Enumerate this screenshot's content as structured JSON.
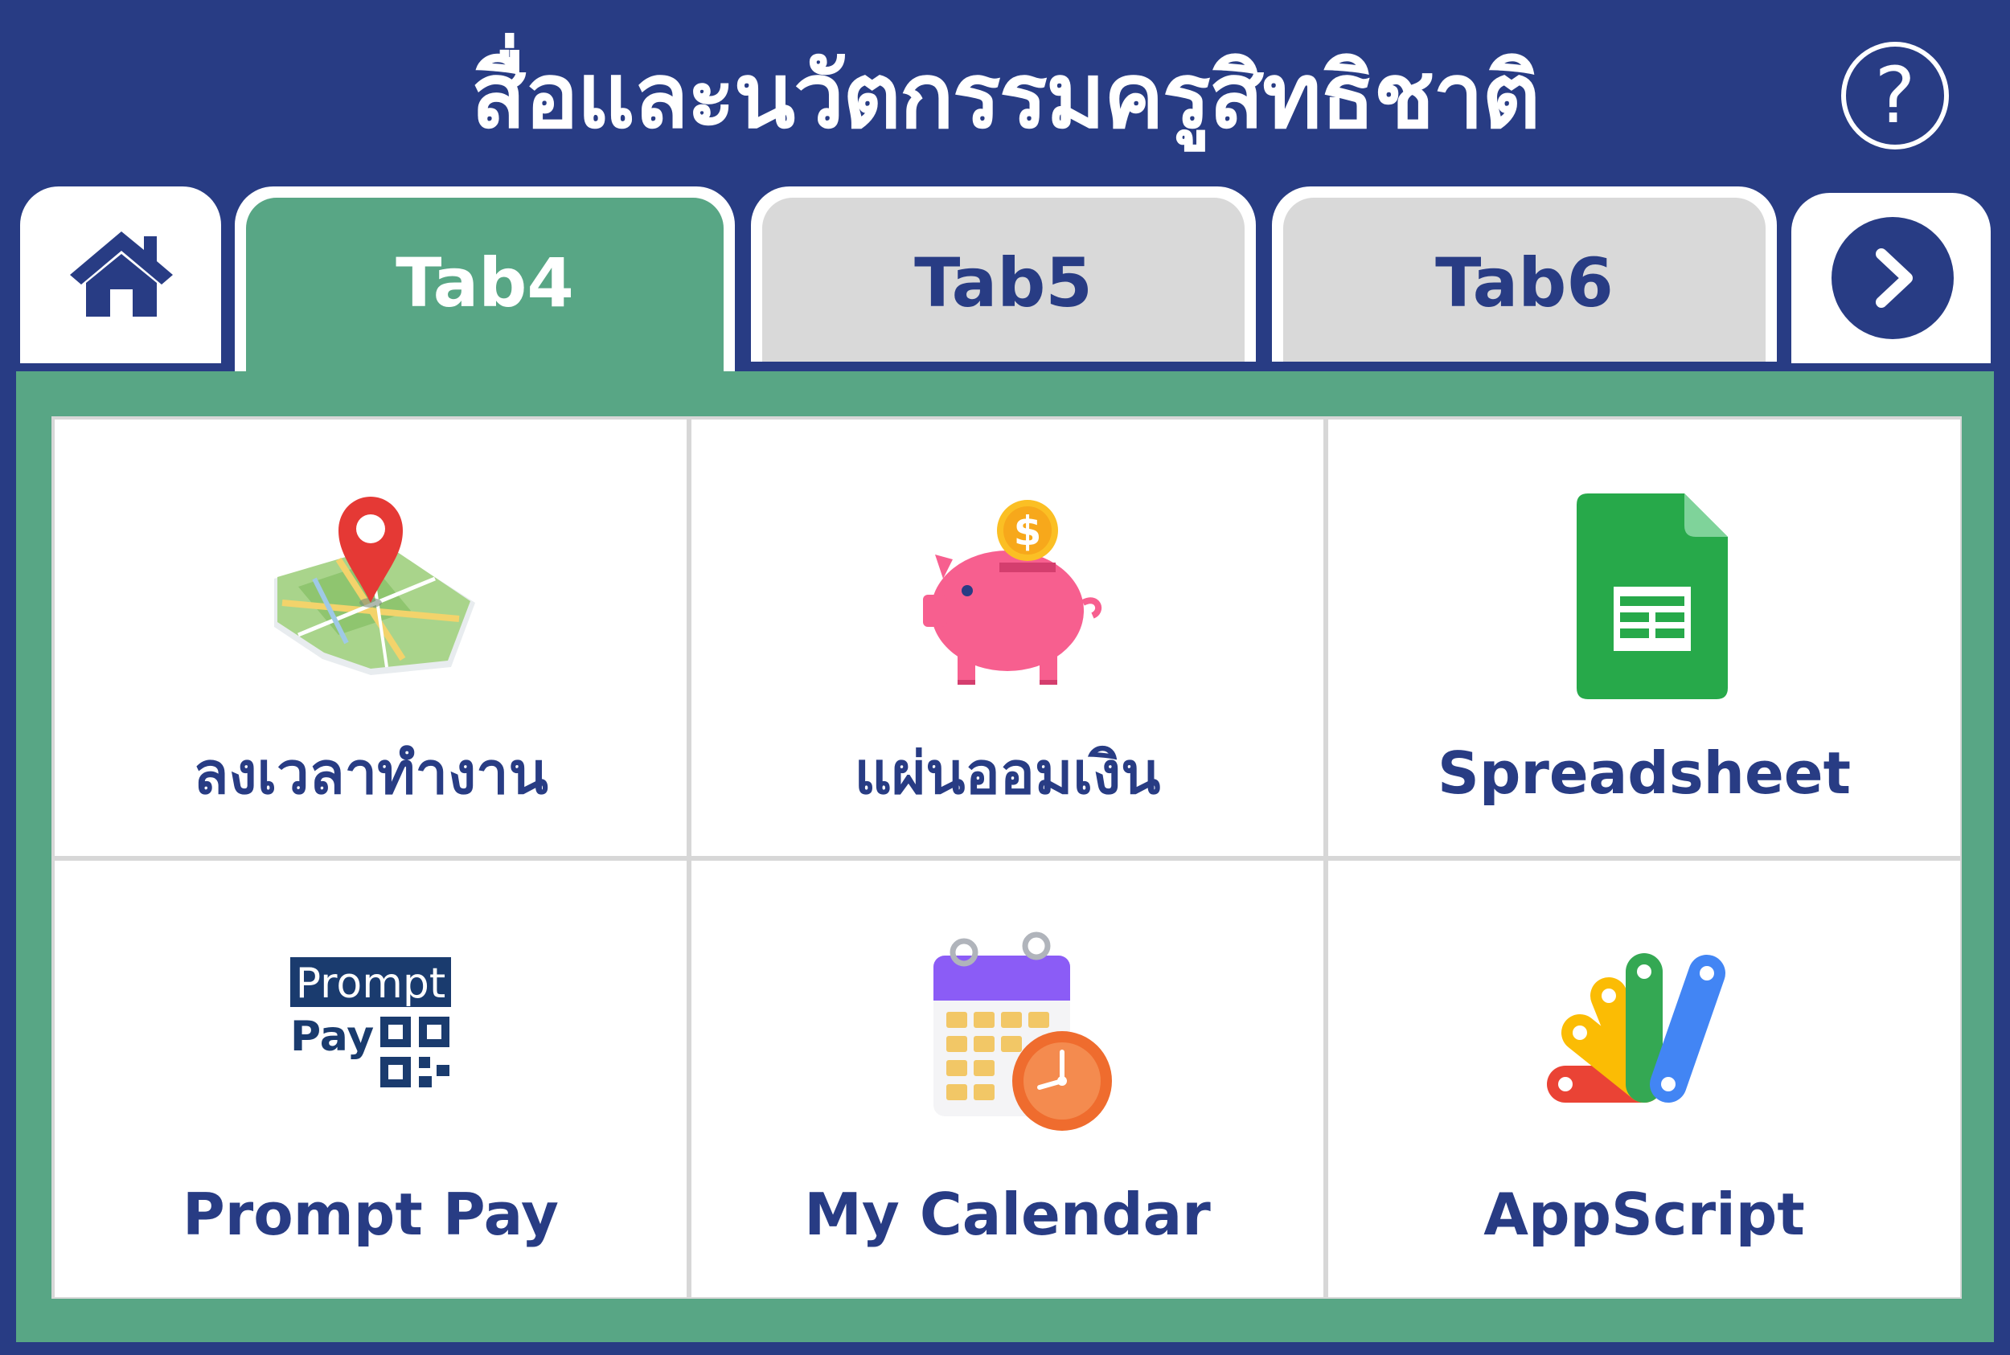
{
  "header": {
    "title": "สื่อและนวัตกรรมครูสิทธิชาติ",
    "help_symbol": "?"
  },
  "tabs": [
    {
      "label": "Tab4",
      "active": true
    },
    {
      "label": "Tab5",
      "active": false
    },
    {
      "label": "Tab6",
      "active": false
    }
  ],
  "nav": {
    "home_icon": "home-icon",
    "next_icon": "chevron-right-icon"
  },
  "cards": [
    {
      "label": "ลงเวลาทำงาน",
      "icon": "map-pin-icon"
    },
    {
      "label": "แผ่นออมเงิน",
      "icon": "piggy-bank-icon"
    },
    {
      "label": "Spreadsheet",
      "icon": "spreadsheet-icon"
    },
    {
      "label": "Prompt Pay",
      "icon": "promptpay-icon",
      "logo_text": [
        "Prompt",
        "Pay"
      ]
    },
    {
      "label": "My Calendar",
      "icon": "calendar-clock-icon"
    },
    {
      "label": "AppScript",
      "icon": "appscript-icon"
    }
  ],
  "colors": {
    "header": "#283c84",
    "panel": "#58a685",
    "tab_inactive": "#d9d9d9",
    "text": "#283c84"
  }
}
